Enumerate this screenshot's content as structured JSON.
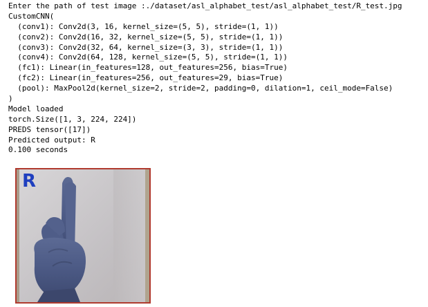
{
  "output": {
    "lines": [
      "Enter the path of test image :./dataset/asl_alphabet_test/asl_alphabet_test/R_test.jpg",
      "CustomCNN(",
      "  (conv1): Conv2d(3, 16, kernel_size=(5, 5), stride=(1, 1))",
      "  (conv2): Conv2d(16, 32, kernel_size=(5, 5), stride=(1, 1))",
      "  (conv3): Conv2d(32, 64, kernel_size=(3, 3), stride=(1, 1))",
      "  (conv4): Conv2d(64, 128, kernel_size=(5, 5), stride=(1, 1))",
      "  (fc1): Linear(in_features=128, out_features=256, bias=True)",
      "  (fc2): Linear(in_features=256, out_features=29, bias=True)",
      "  (pool): MaxPool2d(kernel_size=2, stride=2, padding=0, dilation=1, ceil_mode=False)",
      ")",
      "Model loaded",
      "torch.Size([1, 3, 224, 224])",
      "PREDS tensor([17])",
      "Predicted output: R",
      "0.100 seconds"
    ]
  },
  "image": {
    "letter": "R",
    "border_color": "#b03a2e",
    "letter_color": "#1f3fbf"
  }
}
